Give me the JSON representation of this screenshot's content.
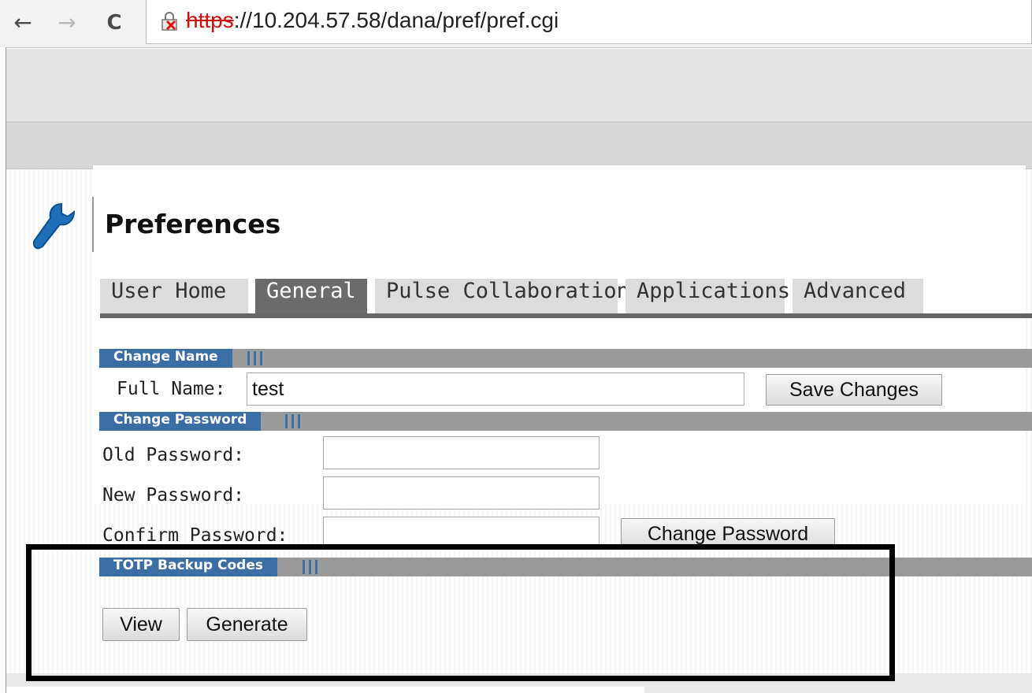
{
  "browser": {
    "back_icon": "←",
    "forward_icon": "→",
    "reload_icon": "C",
    "url_scheme": "https",
    "url_rest": "://10.204.57.58/dana/pref/pref.cgi",
    "insecure_icon": "broken-lock-icon"
  },
  "page": {
    "title": "Preferences",
    "logo_icon": "wrench-icon"
  },
  "tabs": [
    {
      "label": "User Home",
      "active": false
    },
    {
      "label": "General",
      "active": true
    },
    {
      "label": "Pulse Collaboration",
      "active": false
    },
    {
      "label": "Applications",
      "active": false
    },
    {
      "label": "Advanced",
      "active": false
    }
  ],
  "change_name": {
    "section_label": "Change Name",
    "full_name_label": "Full Name:",
    "full_name_value": "test",
    "save_button": "Save Changes"
  },
  "change_password": {
    "section_label": "Change Password",
    "old_label": "Old Password:",
    "new_label": "New Password:",
    "confirm_label": "Confirm Password:",
    "change_button": "Change Password"
  },
  "totp": {
    "section_label": "TOTP Backup Codes",
    "view_button": "View",
    "generate_button": "Generate"
  },
  "colors": {
    "section_blue": "#3c6ea6",
    "active_tab": "#6b6b6b",
    "insecure_red": "#c11"
  }
}
